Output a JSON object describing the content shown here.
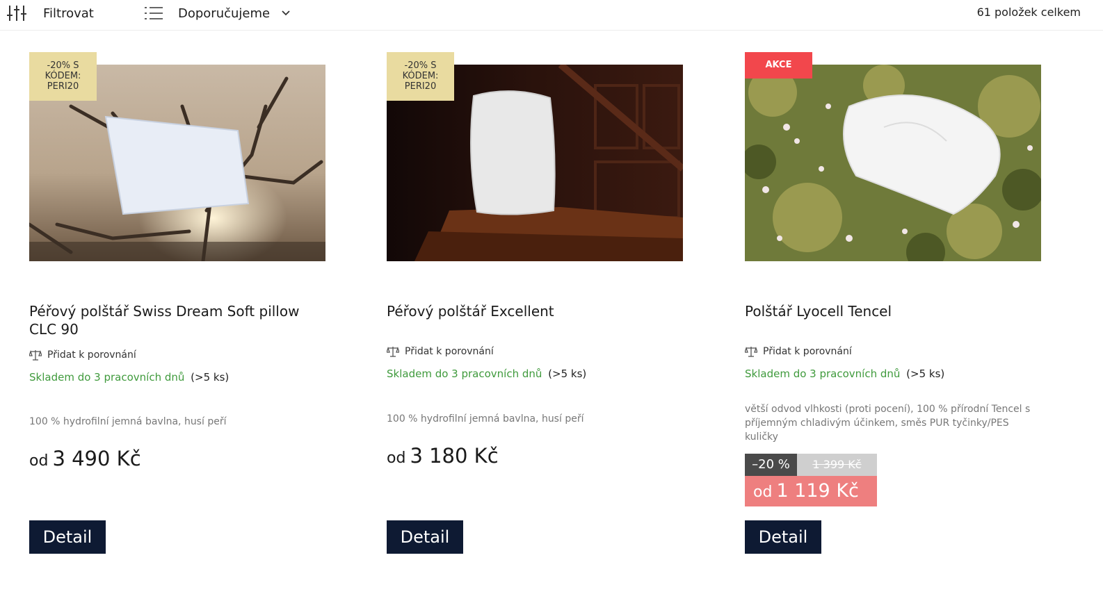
{
  "toolbar": {
    "filter_label": "Filtrovat",
    "sort_label": "Doporučujeme",
    "item_count": "61 položek celkem"
  },
  "products": [
    {
      "badge": "-20% S KÓDEM: PERI20",
      "title": "Péřový polštář Swiss Dream Soft pillow CLC 90",
      "compare": "Přidat k porovnání",
      "stock": "Skladem do 3 pracovních dnů",
      "stock_qty": "(>5 ks)",
      "description": "100 % hydrofilní jemná bavlna, husí peří",
      "price_prefix": "od",
      "price": "3 490 Kč",
      "button": "Detail"
    },
    {
      "badge": "-20% S KÓDEM: PERI20",
      "title": "Péřový polštář Excellent",
      "compare": "Přidat k porovnání",
      "stock": "Skladem do 3 pracovních dnů",
      "stock_qty": "(>5 ks)",
      "description": "100 % hydrofilní jemná bavlna, husí peří",
      "price_prefix": "od",
      "price": "3 180 Kč",
      "button": "Detail"
    },
    {
      "badge": "AKCE",
      "title": "Polštář Lyocell Tencel",
      "compare": "Přidat k porovnání",
      "stock": "Skladem do 3 pracovních dnů",
      "stock_qty": "(>5 ks)",
      "description": "větší odvod vlhkosti (proti pocení), 100 % přírodní Tencel s příjemným chladivým účinkem, směs PUR tyčinky/PES kuličky",
      "discount": "–20 %",
      "old_price": "1 399 Kč",
      "price_prefix": "od",
      "price": "1 119 Kč",
      "button": "Detail"
    }
  ],
  "colors": {
    "stock_green": "#3f9a3c",
    "button_navy": "#0e1a33",
    "promo_badge": "#e9dba0",
    "akce_badge": "#f2474c",
    "sale_price_bg": "#ee7f7f"
  },
  "icons": [
    "filter-sliders-icon",
    "list-icon",
    "chevron-down-icon",
    "scales-icon"
  ]
}
